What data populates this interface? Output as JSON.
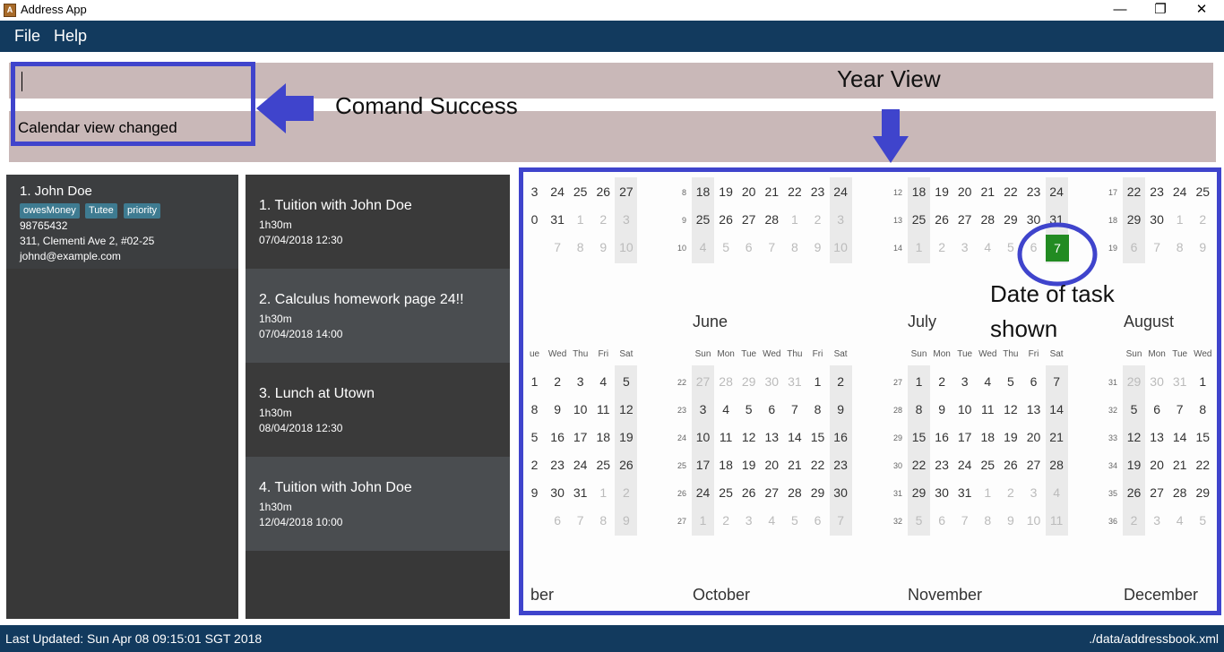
{
  "window": {
    "title": "Address App",
    "minimize_glyph": "—",
    "restore_glyph": "❐",
    "close_glyph": "✕"
  },
  "menu": {
    "file": "File",
    "help": "Help"
  },
  "command": {
    "input_value": "",
    "result": "Calendar view changed"
  },
  "person": {
    "index_name": "1.  John Doe",
    "tags": [
      "owesMoney",
      "Tutee",
      "priority"
    ],
    "phone": "98765432",
    "address": "311, Clementi Ave 2, #02-25",
    "email": "johnd@example.com"
  },
  "tasks": [
    {
      "title": "1.  Tuition with John Doe",
      "duration": "1h30m",
      "datetime": "07/04/2018 12:30"
    },
    {
      "title": "2.  Calculus homework page 24!!",
      "duration": "1h30m",
      "datetime": "07/04/2018 14:00"
    },
    {
      "title": "3.  Lunch at Utown",
      "duration": "1h30m",
      "datetime": "08/04/2018 12:30"
    },
    {
      "title": "4.  Tuition with John Doe",
      "duration": "1h30m",
      "datetime": "12/04/2018 10:00"
    }
  ],
  "calendar": {
    "month_labels": [
      "June",
      "July",
      "August",
      "October",
      "November",
      "December",
      "ber"
    ],
    "dow": [
      "Sun",
      "Mon",
      "Tue",
      "Wed",
      "Thu",
      "Fri",
      "Sat"
    ],
    "highlight_day": "7",
    "highlight_color": "#228b22"
  },
  "annotations": {
    "command_success": "Comand Success",
    "year_view": "Year View",
    "date_of_task": "Date of task",
    "shown": "shown",
    "accent_color": "#3f44cc"
  },
  "status": {
    "last_updated": "Last Updated: Sun Apr 08 09:15:01 SGT 2018",
    "file_path": "./data/addressbook.xml"
  }
}
